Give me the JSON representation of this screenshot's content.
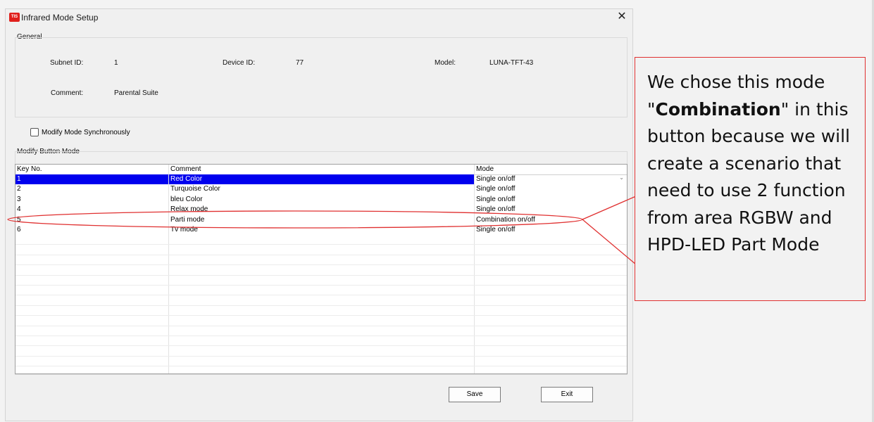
{
  "window": {
    "app_icon_text": "TIS",
    "title": "Infrared Mode Setup",
    "close_glyph": "✕"
  },
  "general": {
    "group_title": "General",
    "subnet_label": "Subnet ID:",
    "subnet_value": "1",
    "device_label": "Device ID:",
    "device_value": "77",
    "model_label": "Model:",
    "model_value": "LUNA-TFT-43",
    "comment_label": "Comment:",
    "comment_value": "Parental Suite"
  },
  "sync_checkbox": {
    "label": "Modify Mode Synchronously",
    "checked": false
  },
  "modify": {
    "group_title": "Modify Button Mode",
    "columns": [
      "Key No.",
      "Comment",
      "Mode"
    ],
    "rows": [
      {
        "key": "1",
        "comment": "Red Color",
        "mode": "Single on/off"
      },
      {
        "key": "2",
        "comment": "Turquoise Color",
        "mode": "Single on/off"
      },
      {
        "key": "3",
        "comment": "bleu Color",
        "mode": "Single on/off"
      },
      {
        "key": "4",
        "comment": "Relax mode",
        "mode": "Single on/off"
      },
      {
        "key": "5",
        "comment": "Parti mode",
        "mode": "Combination on/off"
      },
      {
        "key": "6",
        "comment": "Tv mode",
        "mode": "Single on/off"
      }
    ],
    "selected_key": "1",
    "dropdown_arrow": "⌄"
  },
  "buttons": {
    "save": "Save",
    "exit": "Exit"
  },
  "callout": {
    "text_before": "We chose this mode \"",
    "text_bold": "Combination",
    "text_after": "\" in this button because we will create a scenario that need to use 2 function from area RGBW and HPD-LED Part Mode",
    "border_color": "#e03030"
  },
  "colors": {
    "selection": "#0000ee",
    "annotation": "#e03030",
    "logo": "#e0201c"
  }
}
